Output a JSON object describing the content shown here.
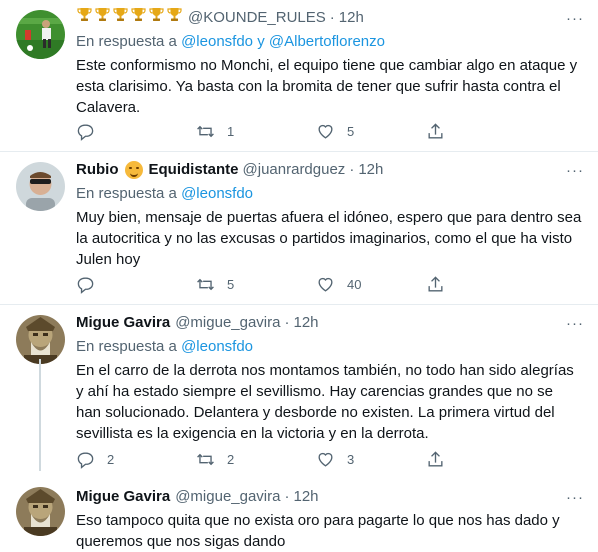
{
  "tweets": [
    {
      "name": "",
      "handle": "@KOUNDE_RULES",
      "time": "12h",
      "trophies": 6,
      "reply_prefix": "En respuesta a",
      "mentions": [
        "@leonsfdo",
        "@Albertoflorenzo"
      ],
      "mention_joiner": "y",
      "text": "Este conformismo no Monchi, el equipo tiene que cambiar algo en ataque y esta clarisimo. Ya basta con la bromita de tener que sufrir hasta contra el Calavera.",
      "replies": "",
      "retweets": "1",
      "likes": "5"
    },
    {
      "name": "Rubio",
      "name_suffix": "Equidistante",
      "handle": "@juanrardguez",
      "time": "12h",
      "reply_prefix": "En respuesta a",
      "mentions": [
        "@leonsfdo"
      ],
      "text": "Muy bien, mensaje de puertas afuera el idóneo, espero que para dentro sea la autocritica y no las excusas o partidos imaginarios, como el que ha visto Julen hoy",
      "replies": "",
      "retweets": "5",
      "likes": "40"
    },
    {
      "name": "Migue Gavira",
      "handle": "@migue_gavira",
      "time": "12h",
      "reply_prefix": "En respuesta a",
      "mentions": [
        "@leonsfdo"
      ],
      "text": "En el carro de la derrota nos montamos también, no todo han sido alegrías y ahí ha estado siempre el sevillismo. Hay carencias grandes que no se han solucionado. Delantera y desborde no existen. La primera virtud del sevillista es la exigencia en la victoria y en la derrota.",
      "replies": "2",
      "retweets": "2",
      "likes": "3"
    },
    {
      "name": "Migue Gavira",
      "handle": "@migue_gavira",
      "time": "12h",
      "text": "Eso tampoco quita que no exista oro para pagarte lo que nos has dado y queremos que nos sigas dando"
    }
  ],
  "ui": {
    "more_glyph": "···",
    "dot": "·"
  },
  "colors": {
    "link": "#1b95e0",
    "secondary": "#536471",
    "border": "#e6ecf0",
    "trophy": "#e6a817"
  }
}
